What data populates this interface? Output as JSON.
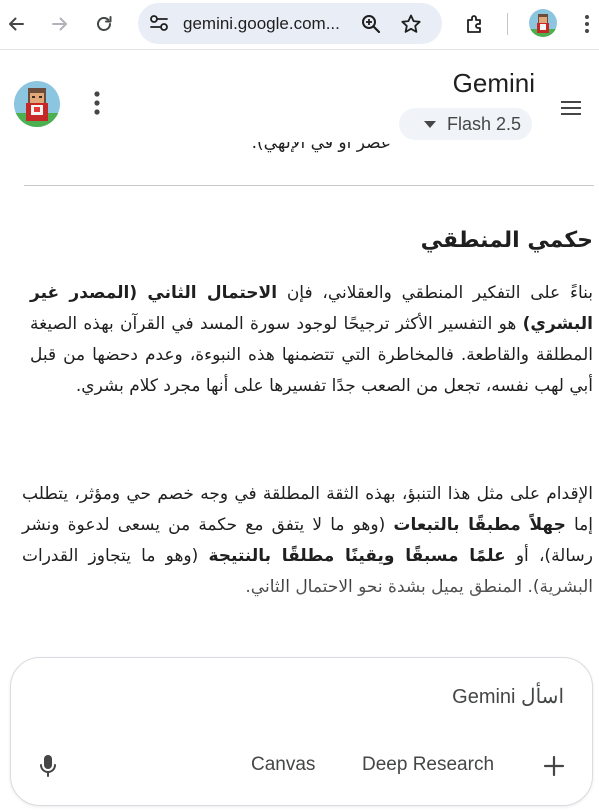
{
  "browser": {
    "url": "gemini.google.com...",
    "icons": [
      "back-arrow-icon",
      "forward-arrow-icon",
      "reload-icon",
      "site-settings-icon",
      "zoom-icon",
      "bookmark-star-icon",
      "extensions-puzzle-icon",
      "profile-avatar",
      "kebab-menu-icon"
    ]
  },
  "header": {
    "title": "Gemini",
    "model_label": "Flash 2.5",
    "icons": [
      "account-avatar",
      "more-vert-icon",
      "hamburger-menu-icon",
      "dropdown-caret-icon"
    ]
  },
  "conversation": {
    "cut_off_line": "عصر أو في الإلهي).",
    "heading": "حكمي المنطقي",
    "para1": {
      "t1": "بناءً على التفكير المنطقي والعقلاني، فإن ",
      "b1": "الاحتمال الثاني (المصدر غير البشري)",
      "t2": " هو التفسير الأكثر ترجيحًا لوجود سورة المسد في القرآن بهذه الصيغة المطلقة والقاطعة. فالمخاطرة التي تتضمنها هذه النبوءة، وعدم دحضها من قبل أبي لهب نفسه، تجعل من الصعب جدًا تفسيرها على أنها مجرد كلام بشري."
    },
    "para2": {
      "t1": "الإقدام على مثل هذا التنبؤ، بهذه الثقة المطلقة في وجه خصم حي ومؤثر، يتطلب إما ",
      "b1": "جهلاً مطبقًا بالتبعات",
      "t2": " (وهو ما لا يتفق مع حكمة من يسعى لدعوة ونشر رسالة)، أو ",
      "b2": "علمًا مسبقًا ويقينًا مطلقًا بالنتيجة",
      "t3": " (وهو ما يتجاوز القدرات البشرية). المنطق يميل بشدة نحو الاحتمال الثاني."
    }
  },
  "prompt": {
    "placeholder": "اسأل Gemini",
    "canvas_label": "Canvas",
    "deep_research_label": "Deep Research",
    "icons": [
      "microphone-icon",
      "add-plus-icon"
    ]
  },
  "colors": {
    "omnibox_bg": "#e9eef6",
    "model_chip_bg": "#f0f4f9",
    "text_primary": "#1f1f1f",
    "text_secondary": "#444746"
  }
}
